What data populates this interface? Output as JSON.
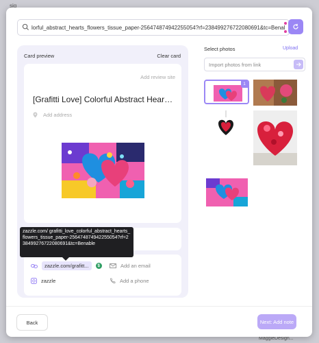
{
  "background": {
    "frag_top": "sig",
    "frag_bottom_right": "MaggieDesign..."
  },
  "search": {
    "value": "lorful_abstract_hearts_flowers_tissue_paper-256474874942255054?rf=238499276722080691&tc=Benable"
  },
  "left_panel": {
    "title": "Card preview",
    "clear_label": "Clear card",
    "card": {
      "add_site_label": "Add review site",
      "title": "[Grafitti Love] Colorful Abstract Hearts...",
      "address_placeholder": "Add address"
    },
    "contact": {
      "link_label": "zazzle.com/grafitt...",
      "email_placeholder": "Add an email",
      "social_label": "zazzle",
      "phone_placeholder": "Add a phone"
    },
    "tooltip": "zazzle.com/\ngrafitti_love_colorful_abstract_hearts_flowers_tissue_paper-256474874942255054?rf=238499276722080691&tc=Benable"
  },
  "right_panel": {
    "title": "Select photos",
    "upload_label": "Upload",
    "import_placeholder": "Import photos from link",
    "selected_badge": "1"
  },
  "footer": {
    "back_label": "Back",
    "next_label": "Next: Add note"
  },
  "colors": {
    "accent": "#9b87f5",
    "accent_light": "#bba9f7",
    "panel_bg": "#f1f0fa"
  }
}
